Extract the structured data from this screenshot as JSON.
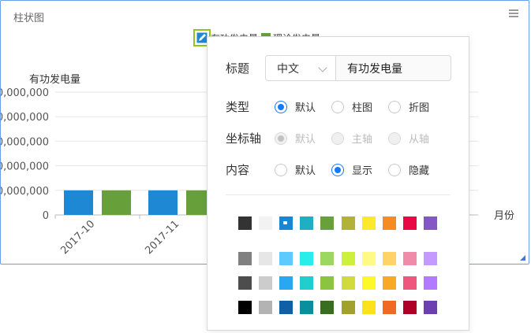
{
  "panel": {
    "title": "柱状图"
  },
  "legend": {
    "items": [
      {
        "label": "有功发电量",
        "color": "#1e88d4"
      },
      {
        "label": "理论发电量",
        "color": "#67a03a"
      }
    ]
  },
  "chart_data": {
    "type": "bar",
    "ylabel": "有功发电量",
    "xlabel": "月份",
    "y_ticks": [
      "0,000,000",
      "0,000,000",
      "0,000,000",
      "0,000,000",
      "0,000,000",
      "0"
    ],
    "categories": [
      "2017-10",
      "2017-11"
    ],
    "series": [
      {
        "name": "有功发电量",
        "values": [
          1,
          1
        ]
      },
      {
        "name": "理论发电量",
        "values": [
          1,
          1
        ]
      }
    ],
    "ylim": [
      0,
      5
    ],
    "grid": true
  },
  "popup": {
    "title_row": {
      "label": "标题",
      "lang_value": "中文",
      "title_value": "有功发电量"
    },
    "type_row": {
      "label": "类型",
      "options": [
        "默认",
        "柱图",
        "折图"
      ],
      "selected": 0
    },
    "axis_row": {
      "label": "坐标轴",
      "options": [
        "默认",
        "主轴",
        "从轴"
      ],
      "selected": 0
    },
    "content_row": {
      "label": "内容",
      "options": [
        "默认",
        "显示",
        "隐藏"
      ],
      "selected": 1
    },
    "palette": [
      [
        "#333333",
        "#f2f2f2",
        "#1787d4",
        "#1eafc2",
        "#68a13a",
        "#b2b23a",
        "#fde92b",
        "#f68b24",
        "#e90945",
        "#8458c4"
      ],
      [
        "#808080",
        "#e6e6e6",
        "#5dcbff",
        "#28ede8",
        "#9cd860",
        "#cdf03b",
        "#fff985",
        "#ffd366",
        "#f08ca9",
        "#c39aff"
      ],
      [
        "#4d4d4d",
        "#cccccc",
        "#28a8f0",
        "#21cecc",
        "#8bc43f",
        "#d1db3e",
        "#fdf82a",
        "#f9a827",
        "#ef577e",
        "#b27bff"
      ],
      [
        "#000000",
        "#b3b3b3",
        "#1160a6",
        "#0b8f9c",
        "#386e21",
        "#a1a12b",
        "#fde21a",
        "#ef6b20",
        "#ae0128",
        "#6d3fb0"
      ]
    ],
    "selected_swatch": [
      0,
      2
    ]
  }
}
